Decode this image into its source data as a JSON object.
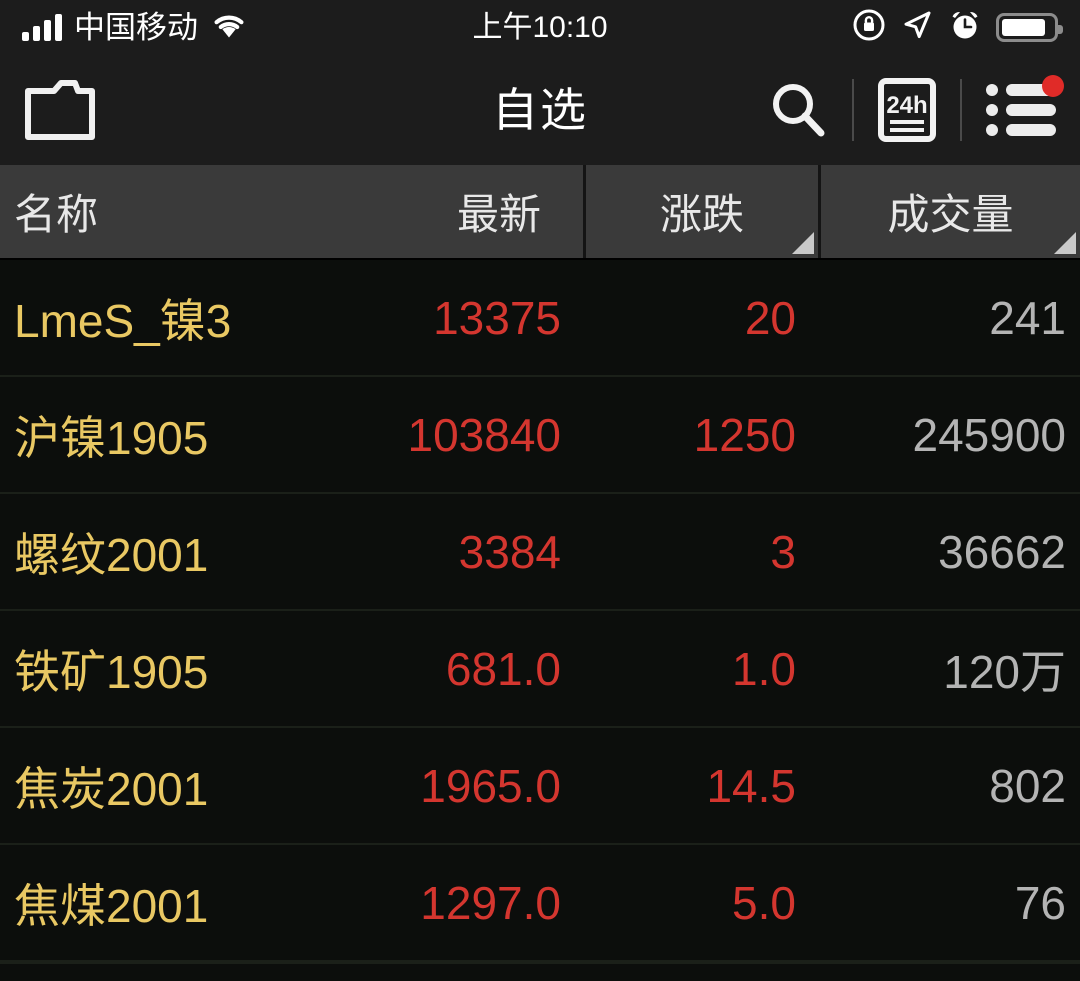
{
  "status_bar": {
    "carrier": "中国移动",
    "signal_icon": "signal-bars-icon",
    "wifi_icon": "wifi-icon",
    "time": "上午10:10",
    "rotation_lock_icon": "rotation-lock-icon",
    "location_icon": "location-arrow-icon",
    "alarm_icon": "alarm-clock-icon",
    "battery_icon": "battery-icon",
    "battery_level_percent": 85
  },
  "nav_bar": {
    "folder_icon": "folder-icon",
    "title": "自选",
    "search_icon": "search-icon",
    "news_icon": "24h-news-icon",
    "news_icon_label": "24h",
    "list_icon": "list-menu-icon",
    "badge_visible": true,
    "badge_color": "#e02b28"
  },
  "table": {
    "columns": [
      {
        "key": "name",
        "label": "名称",
        "sortable": false
      },
      {
        "key": "last",
        "label": "最新",
        "sortable": false
      },
      {
        "key": "change",
        "label": "涨跌",
        "sortable": true
      },
      {
        "key": "volume",
        "label": "成交量",
        "sortable": true
      }
    ],
    "rows": [
      {
        "name": "LmeS_镍3",
        "last": "13375",
        "change": "20",
        "volume": "241"
      },
      {
        "name": "沪镍1905",
        "last": "103840",
        "change": "1250",
        "volume": "245900"
      },
      {
        "name": "螺纹2001",
        "last": "3384",
        "change": "3",
        "volume": "36662"
      },
      {
        "name": "铁矿1905",
        "last": "681.0",
        "change": "1.0",
        "volume": "120万"
      },
      {
        "name": "焦炭2001",
        "last": "1965.0",
        "change": "14.5",
        "volume": "802"
      },
      {
        "name": "焦煤2001",
        "last": "1297.0",
        "change": "5.0",
        "volume": "76"
      }
    ]
  },
  "colors": {
    "name_text": "#e9c863",
    "up_red": "#d4362f",
    "volume_text": "#b4b4b4",
    "header_bg": "#3a3a3a",
    "page_bg": "#0c0e0c",
    "chrome_bg": "#1c1c1c"
  }
}
